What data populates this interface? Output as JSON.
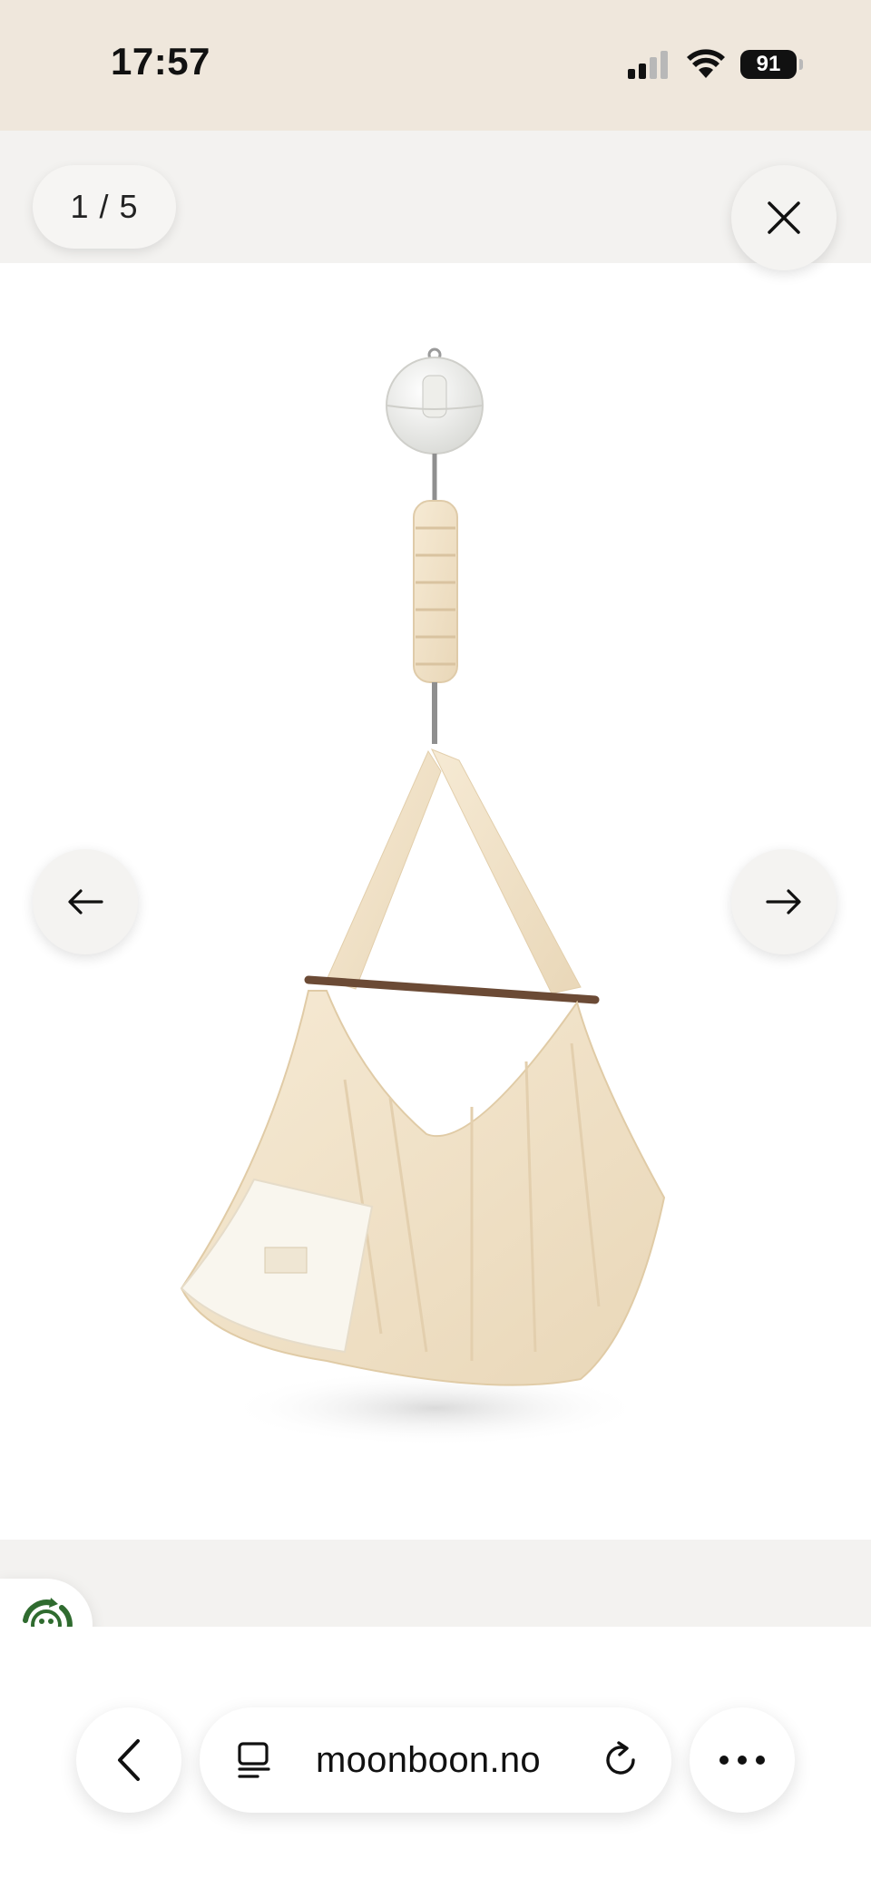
{
  "status_bar": {
    "time": "17:57",
    "battery": "91",
    "icons": [
      "cellular-signal-icon",
      "wifi-icon",
      "battery-icon"
    ]
  },
  "viewer": {
    "counter": "1 / 5",
    "icons": [
      "close-icon",
      "arrow-left-icon",
      "arrow-right-icon"
    ]
  },
  "product_image": {
    "icon": "hanging-baby-hammock-image"
  },
  "eco_badge": {
    "icon": "recycle-eco-icon",
    "color": "#2f6b2f"
  },
  "browser": {
    "url": "moonboon.no",
    "icons": [
      "back-chevron-icon",
      "reader-mode-icon",
      "reload-icon",
      "more-icon"
    ]
  }
}
